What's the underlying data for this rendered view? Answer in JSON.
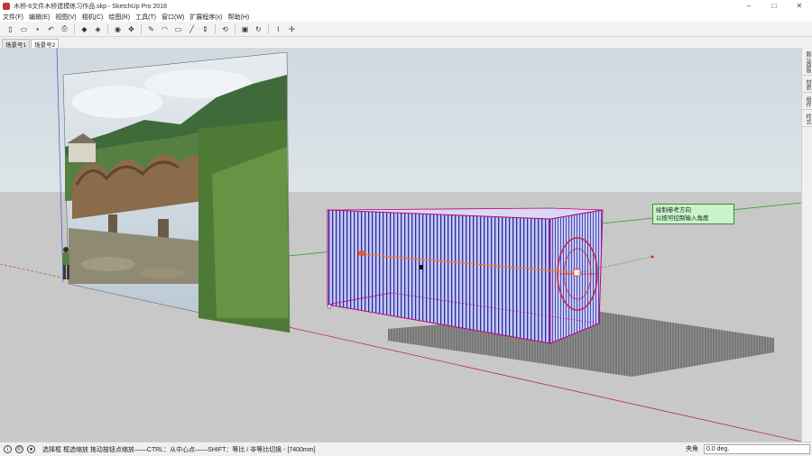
{
  "window": {
    "title": "木桥-6文件木桥建模练习作品.skp - SketchUp Pro 2018",
    "controls": [
      "–",
      "□",
      "✕"
    ]
  },
  "menu": [
    "文件(F)",
    "编辑(E)",
    "视图(V)",
    "相机(C)",
    "绘图(R)",
    "工具(T)",
    "窗口(W)",
    "扩展程序(x)",
    "帮助(H)"
  ],
  "scenes": [
    "场景号1",
    "场景号2"
  ],
  "tray": [
    "默认面板",
    "材质",
    "组件",
    "样式"
  ],
  "tooltip": {
    "line1": "绘制参考方向",
    "line2": "以按可控制输入角度"
  },
  "status": {
    "hint": "选择框 框选缩放 拖动按钮点缩放——CTRL：从中心点——SHIFT：等比 / 非等比切换 - [7400mm]",
    "measure_label": "夹角",
    "measure_value": "0.0 deg."
  }
}
